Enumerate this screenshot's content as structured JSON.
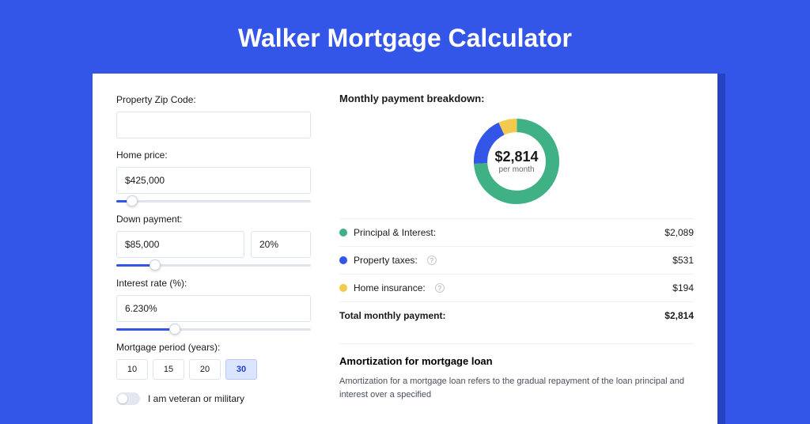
{
  "title": "Walker Mortgage Calculator",
  "colors": {
    "green": "#3fb185",
    "blue": "#3355e8",
    "yellow": "#f3ca4d"
  },
  "left": {
    "zip_label": "Property Zip Code:",
    "zip_value": "",
    "price_label": "Home price:",
    "price_value": "$425,000",
    "price_pct": 8,
    "down_label": "Down payment:",
    "down_value": "$85,000",
    "down_pct_value": "20%",
    "down_track_pct": 20,
    "rate_label": "Interest rate (%):",
    "rate_value": "6.230%",
    "rate_track_pct": 30,
    "period_label": "Mortgage period (years):",
    "period_options": [
      "10",
      "15",
      "20",
      "30"
    ],
    "period_selected": "30",
    "veteran_label": "I am veteran or military"
  },
  "right": {
    "breakdown_title": "Monthly payment breakdown:",
    "donut_value": "$2,814",
    "donut_sub": "per month",
    "rows": [
      {
        "label": "Principal & Interest:",
        "value": "$2,089",
        "color": "green",
        "help": false,
        "pct": 74
      },
      {
        "label": "Property taxes:",
        "value": "$531",
        "color": "blue",
        "help": true,
        "pct": 19
      },
      {
        "label": "Home insurance:",
        "value": "$194",
        "color": "yellow",
        "help": true,
        "pct": 7
      }
    ],
    "total_label": "Total monthly payment:",
    "total_value": "$2,814",
    "amort_title": "Amortization for mortgage loan",
    "amort_text": "Amortization for a mortgage loan refers to the gradual repayment of the loan principal and interest over a specified"
  },
  "chart_data": {
    "type": "pie",
    "title": "Monthly payment breakdown",
    "categories": [
      "Principal & Interest",
      "Property taxes",
      "Home insurance"
    ],
    "values": [
      2089,
      531,
      194
    ],
    "total": 2814,
    "center_label": "$2,814 per month"
  }
}
